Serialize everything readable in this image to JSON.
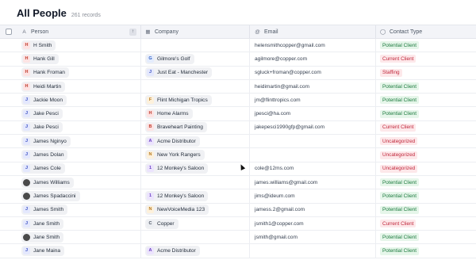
{
  "page": {
    "title": "All People",
    "record_count": "261 records"
  },
  "columns": {
    "person": {
      "label": "Person",
      "icon": "person-icon"
    },
    "company": {
      "label": "Company",
      "icon": "building-icon"
    },
    "email": {
      "label": "Email",
      "icon": "at-sign-icon"
    },
    "contact_type": {
      "label": "Contact Type",
      "icon": "tag-icon"
    }
  },
  "colors": {
    "potential": {
      "bg": "#e6f6ea",
      "fg": "#1b7a3d"
    },
    "current": {
      "bg": "#fde8ea",
      "fg": "#c0263a"
    },
    "staffing": {
      "bg": "#fde8ea",
      "fg": "#c0263a"
    },
    "uncategorized": {
      "bg": "#fde8ea",
      "fg": "#c0263a"
    }
  },
  "rows": [
    {
      "person": "H Smith",
      "person_initial": "H",
      "person_avatar": "initial",
      "company": "",
      "company_initial": "",
      "email": "helensmithcopper@gmail.com",
      "type": "Potential Client",
      "type_kind": "potential"
    },
    {
      "person": "Hank Gill",
      "person_initial": "H",
      "person_avatar": "initial",
      "company": "Gilmore's Golf",
      "company_initial": "G",
      "email": "agilmore@copper.com",
      "type": "Current Client",
      "type_kind": "current"
    },
    {
      "person": "Hank Froman",
      "person_initial": "H",
      "person_avatar": "initial",
      "company": "Just Eat - Manchester",
      "company_initial": "J",
      "email": "sgluck+froman@copper.com",
      "type": "Staffing",
      "type_kind": "staffing"
    },
    {
      "person": "Heidi Martin",
      "person_initial": "H",
      "person_avatar": "initial",
      "company": "",
      "company_initial": "",
      "email": "heidimartin@gmail.com",
      "type": "Potential Client",
      "type_kind": "potential"
    },
    {
      "person": "Jackie Moon",
      "person_initial": "J",
      "person_avatar": "initial",
      "company": "Flint Michigan Tropics",
      "company_initial": "F",
      "email": "jm@flinttropics.com",
      "type": "Potential Client",
      "type_kind": "potential"
    },
    {
      "person": "Jake Pesci",
      "person_initial": "J",
      "person_avatar": "initial",
      "company": "Home Alarms",
      "company_initial": "H",
      "email": "jpesci@ha.com",
      "type": "Potential Client",
      "type_kind": "potential"
    },
    {
      "person": "Jake Pesci",
      "person_initial": "J",
      "person_avatar": "initial",
      "company": "Braveheart Painting",
      "company_initial": "B",
      "email": "jakepesci1990gfp@gmail.com",
      "type": "Current Client",
      "type_kind": "current"
    },
    {
      "person": "James Nginyo",
      "person_initial": "J",
      "person_avatar": "initial",
      "company": "Acme Distributor",
      "company_initial": "A",
      "email": "",
      "type": "Uncategorized",
      "type_kind": "uncategorized"
    },
    {
      "person": "James Dolan",
      "person_initial": "J",
      "person_avatar": "initial",
      "company": "New York Rangers",
      "company_initial": "N",
      "email": "",
      "type": "Uncategorized",
      "type_kind": "uncategorized"
    },
    {
      "person": "James Cole",
      "person_initial": "J",
      "person_avatar": "initial",
      "company": "12 Monkey's Saloon",
      "company_initial": "1",
      "email": "cole@12ms.com",
      "type": "Uncategorized",
      "type_kind": "uncategorized"
    },
    {
      "person": "James Williams",
      "person_initial": "J",
      "person_avatar": "photo",
      "company": "",
      "company_initial": "",
      "email": "james.williams@gmail.com",
      "type": "Potential Client",
      "type_kind": "potential"
    },
    {
      "person": "James Spadaccini",
      "person_initial": "J",
      "person_avatar": "photo",
      "company": "12 Monkey's Saloon",
      "company_initial": "1",
      "email": "jims@ideum.com",
      "type": "Potential Client",
      "type_kind": "potential"
    },
    {
      "person": "James Smith",
      "person_initial": "J",
      "person_avatar": "initial",
      "company": "NewVoiceMedia 123",
      "company_initial": "N",
      "email": "jamess.2@gmail.com",
      "type": "Potential Client",
      "type_kind": "potential"
    },
    {
      "person": "Jane Smith",
      "person_initial": "J",
      "person_avatar": "initial",
      "company": "Copper",
      "company_initial": "C",
      "email": "jsmith1@copper.com",
      "type": "Current Client",
      "type_kind": "current"
    },
    {
      "person": "Jane Smith",
      "person_initial": "J",
      "person_avatar": "photo",
      "company": "",
      "company_initial": "",
      "email": "jsmith@gmail.com",
      "type": "Potential Client",
      "type_kind": "potential"
    },
    {
      "person": "Jane Maina",
      "person_initial": "J",
      "person_avatar": "initial",
      "company": "Acme Distributor",
      "company_initial": "A",
      "email": "",
      "type": "Potential Client",
      "type_kind": "potential"
    }
  ]
}
